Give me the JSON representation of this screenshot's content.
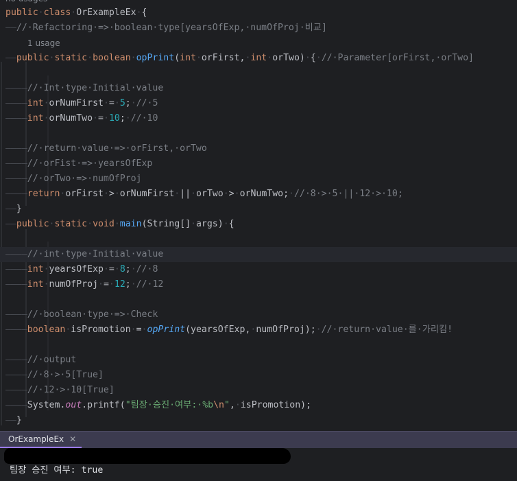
{
  "editor": {
    "usage_hint_top": "no usages",
    "usage_hint_oprint": "1 usage",
    "lines": [
      {
        "tokens": [
          [
            "kw",
            "public"
          ],
          [
            "ws",
            "·"
          ],
          [
            "kw",
            "class"
          ],
          [
            "ws",
            "·"
          ],
          [
            "pl",
            "OrExampleEx"
          ],
          [
            "ws",
            "·"
          ],
          [
            "pl",
            "{"
          ]
        ]
      },
      {
        "tokens": [
          [
            "ws",
            "——"
          ],
          [
            "cm",
            "//·Refactoring·=>·boolean·type[yearsOfExp,·numOfProj·비교]"
          ]
        ]
      },
      {
        "tokens": [
          [
            "ws",
            "——"
          ],
          [
            "kw",
            "public"
          ],
          [
            "ws",
            "·"
          ],
          [
            "kw",
            "static"
          ],
          [
            "ws",
            "·"
          ],
          [
            "kw",
            "boolean"
          ],
          [
            "ws",
            "·"
          ],
          [
            "fn",
            "opPrint"
          ],
          [
            "pl",
            "("
          ],
          [
            "kw",
            "int"
          ],
          [
            "ws",
            "·"
          ],
          [
            "pl",
            "orFirst,"
          ],
          [
            "ws",
            "·"
          ],
          [
            "kw",
            "int"
          ],
          [
            "ws",
            "·"
          ],
          [
            "pl",
            "orTwo)"
          ],
          [
            "ws",
            "·"
          ],
          [
            "pl",
            "{"
          ],
          [
            "ws",
            "·"
          ],
          [
            "cm",
            "//·Parameter[orFirst,·orTwo]"
          ]
        ]
      },
      {
        "tokens": []
      },
      {
        "tokens": [
          [
            "ws",
            "————"
          ],
          [
            "cm",
            "//·Int·type·Initial·value"
          ]
        ]
      },
      {
        "tokens": [
          [
            "ws",
            "————"
          ],
          [
            "kw",
            "int"
          ],
          [
            "ws",
            "·"
          ],
          [
            "pl",
            "orNumFirst"
          ],
          [
            "ws",
            "·"
          ],
          [
            "pl",
            "="
          ],
          [
            "ws",
            "·"
          ],
          [
            "num",
            "5"
          ],
          [
            "pl",
            ";"
          ],
          [
            "ws",
            "·"
          ],
          [
            "cm",
            "//·5"
          ]
        ]
      },
      {
        "tokens": [
          [
            "ws",
            "————"
          ],
          [
            "kw",
            "int"
          ],
          [
            "ws",
            "·"
          ],
          [
            "pl",
            "orNumTwo"
          ],
          [
            "ws",
            "·"
          ],
          [
            "pl",
            "="
          ],
          [
            "ws",
            "·"
          ],
          [
            "num",
            "10"
          ],
          [
            "pl",
            ";"
          ],
          [
            "ws",
            "·"
          ],
          [
            "cm",
            "//·10"
          ]
        ]
      },
      {
        "tokens": []
      },
      {
        "tokens": [
          [
            "ws",
            "————"
          ],
          [
            "cm",
            "//·return·value·=>·orFirst,·orTwo"
          ]
        ]
      },
      {
        "tokens": [
          [
            "ws",
            "————"
          ],
          [
            "cm",
            "//·orFist·=>·yearsOfExp"
          ]
        ]
      },
      {
        "tokens": [
          [
            "ws",
            "————"
          ],
          [
            "cm",
            "//·orTwo·=>·numOfProj"
          ]
        ]
      },
      {
        "tokens": [
          [
            "ws",
            "————"
          ],
          [
            "kw",
            "return"
          ],
          [
            "ws",
            "·"
          ],
          [
            "pl",
            "orFirst"
          ],
          [
            "ws",
            "·"
          ],
          [
            "pl",
            ">"
          ],
          [
            "ws",
            "·"
          ],
          [
            "pl",
            "orNumFirst"
          ],
          [
            "ws",
            "·"
          ],
          [
            "pl",
            "||"
          ],
          [
            "ws",
            "·"
          ],
          [
            "pl",
            "orTwo"
          ],
          [
            "ws",
            "·"
          ],
          [
            "pl",
            ">"
          ],
          [
            "ws",
            "·"
          ],
          [
            "pl",
            "orNumTwo;"
          ],
          [
            "ws",
            "·"
          ],
          [
            "cm",
            "//·8·>·5·||·12·>·10;"
          ]
        ]
      },
      {
        "tokens": [
          [
            "ws",
            "——"
          ],
          [
            "pl",
            "}"
          ]
        ]
      },
      {
        "tokens": [
          [
            "ws",
            "——"
          ],
          [
            "kw",
            "public"
          ],
          [
            "ws",
            "·"
          ],
          [
            "kw",
            "static"
          ],
          [
            "ws",
            "·"
          ],
          [
            "kw",
            "void"
          ],
          [
            "ws",
            "·"
          ],
          [
            "fn",
            "main"
          ],
          [
            "pl",
            "(String[]"
          ],
          [
            "ws",
            "·"
          ],
          [
            "pl",
            "args)"
          ],
          [
            "ws",
            "·"
          ],
          [
            "pl",
            "{"
          ]
        ]
      },
      {
        "tokens": []
      },
      {
        "tokens": [
          [
            "ws",
            "————"
          ],
          [
            "cm",
            "//·int·type·Initial·value"
          ]
        ]
      },
      {
        "tokens": [
          [
            "ws",
            "————"
          ],
          [
            "kw",
            "int"
          ],
          [
            "ws",
            "·"
          ],
          [
            "pl",
            "yearsOfExp"
          ],
          [
            "ws",
            "·"
          ],
          [
            "pl",
            "="
          ],
          [
            "ws",
            "·"
          ],
          [
            "num",
            "8"
          ],
          [
            "pl",
            ";"
          ],
          [
            "ws",
            "·"
          ],
          [
            "cm",
            "//·8"
          ]
        ]
      },
      {
        "tokens": [
          [
            "ws",
            "————"
          ],
          [
            "kw",
            "int"
          ],
          [
            "ws",
            "·"
          ],
          [
            "pl",
            "numOfProj"
          ],
          [
            "ws",
            "·"
          ],
          [
            "pl",
            "="
          ],
          [
            "ws",
            "·"
          ],
          [
            "num",
            "12"
          ],
          [
            "pl",
            ";"
          ],
          [
            "ws",
            "·"
          ],
          [
            "cm",
            "//·12"
          ]
        ]
      },
      {
        "tokens": []
      },
      {
        "tokens": [
          [
            "ws",
            "————"
          ],
          [
            "cm",
            "//·boolean·type·=>·Check"
          ]
        ]
      },
      {
        "tokens": [
          [
            "ws",
            "————"
          ],
          [
            "kw",
            "boolean"
          ],
          [
            "ws",
            "·"
          ],
          [
            "pl",
            "isPromotion"
          ],
          [
            "ws",
            "·"
          ],
          [
            "pl",
            "="
          ],
          [
            "ws",
            "·"
          ],
          [
            "fnc",
            "opPrint"
          ],
          [
            "pl",
            "(yearsOfExp,"
          ],
          [
            "ws",
            "·"
          ],
          [
            "pl",
            "numOfProj);"
          ],
          [
            "ws",
            "·"
          ],
          [
            "cm",
            "//·return·value·를·가리킴!"
          ]
        ]
      },
      {
        "tokens": []
      },
      {
        "tokens": [
          [
            "ws",
            "————"
          ],
          [
            "cm",
            "//·output"
          ]
        ]
      },
      {
        "tokens": [
          [
            "ws",
            "————"
          ],
          [
            "cm",
            "//·8·>·5[True]"
          ]
        ]
      },
      {
        "tokens": [
          [
            "ws",
            "————"
          ],
          [
            "cm",
            "//·12·>·10[True]"
          ]
        ]
      },
      {
        "tokens": [
          [
            "ws",
            "————"
          ],
          [
            "pl",
            "System."
          ],
          [
            "fld",
            "out"
          ],
          [
            "pl",
            ".printf("
          ],
          [
            "str",
            "\"팀장·승진·여부:·%b"
          ],
          [
            "esc",
            "\\n"
          ],
          [
            "str",
            "\""
          ],
          [
            "pl",
            ","
          ],
          [
            "ws",
            "·"
          ],
          [
            "pl",
            "isPromotion);"
          ]
        ]
      },
      {
        "tokens": [
          [
            "ws",
            "——"
          ],
          [
            "pl",
            "}"
          ]
        ]
      }
    ]
  },
  "run_panel": {
    "tab_label": "OrExampleEx",
    "output_line": "팀장 승진 여부: true"
  }
}
